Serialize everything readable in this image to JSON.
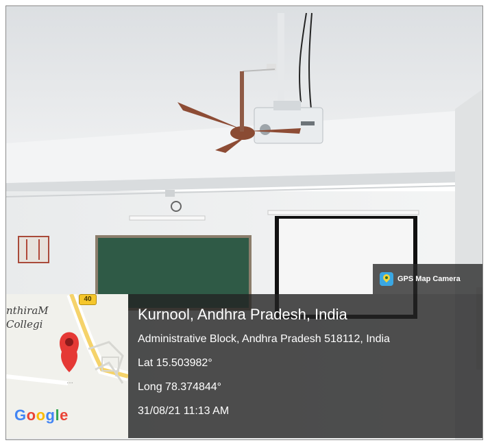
{
  "overlay": {
    "app_name": "GPS Map Camera",
    "app_icon": "gps-map-camera-icon",
    "location_title": "Kurnool, Andhra Pradesh, India",
    "address": "Administrative Block, Andhra Pradesh 518112, India",
    "latitude": "Lat 15.503982°",
    "longitude": "Long 78.374844°",
    "datetime": "31/08/21 11:13 AM"
  },
  "map": {
    "road_number": "40",
    "place_label_line1": "nthiraM",
    "place_label_line2": "Collegi",
    "marker_icon": "map-pin-icon",
    "provider_logo": [
      "G",
      "o",
      "o",
      "g",
      "l",
      "e"
    ]
  },
  "colors": {
    "overlay_bg": "#232323",
    "pin": "#e53935",
    "chalkboard": "#2f5a46"
  }
}
